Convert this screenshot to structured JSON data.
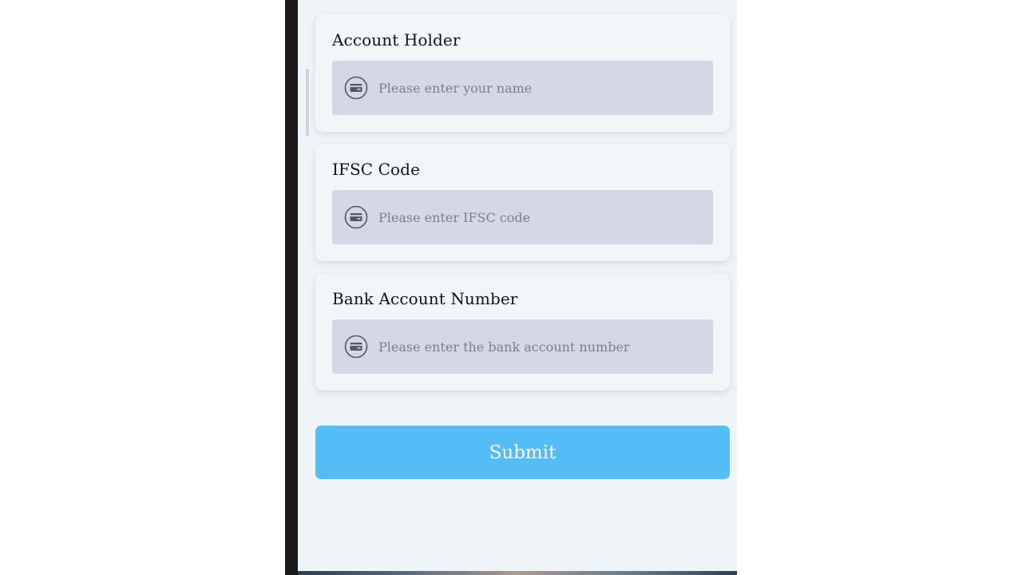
{
  "form": {
    "fields": [
      {
        "label": "Account Holder",
        "placeholder": "Please enter your name",
        "value": "",
        "icon": "credit-card-icon"
      },
      {
        "label": "IFSC Code",
        "placeholder": "Please enter IFSC code",
        "value": "",
        "icon": "credit-card-icon"
      },
      {
        "label": "Bank Account Number",
        "placeholder": "Please enter the bank account number",
        "value": "",
        "icon": "credit-card-icon"
      }
    ],
    "submit_label": "Submit"
  },
  "colors": {
    "accent": "#55bdf5",
    "input_background": "#d4d7e6",
    "card_background": "#f3f6f9",
    "page_background": "#eff4f8"
  }
}
